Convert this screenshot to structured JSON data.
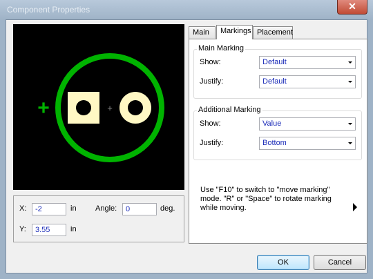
{
  "window": {
    "title": "Component Properties",
    "close_symbol": "✕"
  },
  "position": {
    "x_label": "X:",
    "x_value": "-2",
    "x_unit": "in",
    "y_label": "Y:",
    "y_value": "3.55",
    "y_unit": "in",
    "angle_label": "Angle:",
    "angle_value": "0",
    "angle_unit": "deg."
  },
  "preview": {
    "plus_symbol": "+",
    "center_symbol": "+"
  },
  "tabs": [
    {
      "label": "Main"
    },
    {
      "label": "Markings"
    },
    {
      "label": "Placement"
    }
  ],
  "main_marking": {
    "title": "Main Marking",
    "show_label": "Show:",
    "show_value": "Default",
    "justify_label": "Justify:",
    "justify_value": "Default"
  },
  "additional_marking": {
    "title": "Additional Marking",
    "show_label": "Show:",
    "show_value": "Value",
    "justify_label": "Justify:",
    "justify_value": "Bottom"
  },
  "hint": "Use \"F10\" to switch to \"move marking\" mode. \"R\" or \"Space\" to rotate marking while moving.",
  "buttons": {
    "ok": "OK",
    "cancel": "Cancel"
  },
  "colors": {
    "outline": "#00b300",
    "pad": "#fff8c4",
    "background": "#000000"
  }
}
